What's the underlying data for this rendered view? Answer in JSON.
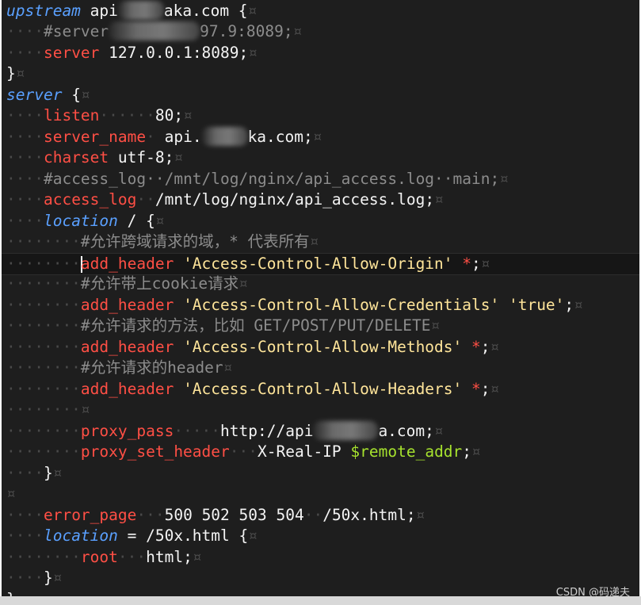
{
  "lines": [
    {
      "ws": "",
      "tokens": [
        {
          "t": "kw",
          "v": "upstream"
        },
        {
          "t": "txt",
          "v": " api"
        },
        {
          "t": "blur",
          "w": 58
        },
        {
          "t": "txt",
          "v": "aka.com {"
        },
        {
          "t": "ws",
          "v": "¤"
        }
      ]
    },
    {
      "ws": "····",
      "tokens": [
        {
          "t": "cmt",
          "v": "#server"
        },
        {
          "t": "blur",
          "w": 115
        },
        {
          "t": "cmt",
          "v": "97.9:8089;"
        },
        {
          "t": "ws",
          "v": "¤"
        }
      ]
    },
    {
      "ws": "····",
      "tokens": [
        {
          "t": "dir",
          "v": "server"
        },
        {
          "t": "txt",
          "v": " 127.0.0.1:8089;"
        },
        {
          "t": "ws",
          "v": "¤"
        }
      ]
    },
    {
      "ws": "",
      "tokens": [
        {
          "t": "txt",
          "v": "}"
        },
        {
          "t": "ws",
          "v": "¤"
        }
      ]
    },
    {
      "ws": "",
      "tokens": [
        {
          "t": "kw",
          "v": "server"
        },
        {
          "t": "txt",
          "v": " {"
        },
        {
          "t": "ws",
          "v": "¤"
        }
      ]
    },
    {
      "ws": "····",
      "tokens": [
        {
          "t": "dir",
          "v": "listen"
        },
        {
          "t": "ws",
          "v": "······"
        },
        {
          "t": "txt",
          "v": "80;"
        },
        {
          "t": "ws",
          "v": "¤"
        }
      ]
    },
    {
      "ws": "····",
      "tokens": [
        {
          "t": "dir",
          "v": "server_name"
        },
        {
          "t": "ws",
          "v": "·"
        },
        {
          "t": "txt",
          "v": " api."
        },
        {
          "t": "blur",
          "w": 58
        },
        {
          "t": "txt",
          "v": "ka.com;"
        },
        {
          "t": "ws",
          "v": "¤"
        }
      ]
    },
    {
      "ws": "····",
      "tokens": [
        {
          "t": "dir",
          "v": "charset"
        },
        {
          "t": "txt",
          "v": " utf-8;"
        },
        {
          "t": "ws",
          "v": "¤"
        }
      ]
    },
    {
      "ws": "····",
      "tokens": [
        {
          "t": "cmt",
          "v": "#access_log··/mnt/log/nginx/api_access.log··main;"
        },
        {
          "t": "ws",
          "v": "¤"
        }
      ]
    },
    {
      "ws": "····",
      "tokens": [
        {
          "t": "dir",
          "v": "access_log"
        },
        {
          "t": "ws",
          "v": "··"
        },
        {
          "t": "txt",
          "v": "/mnt/log/nginx/api_access.log;"
        },
        {
          "t": "ws",
          "v": "¤"
        }
      ]
    },
    {
      "ws": "····",
      "tokens": [
        {
          "t": "kw",
          "v": "location"
        },
        {
          "t": "txt",
          "v": " / {"
        },
        {
          "t": "ws",
          "v": "¤"
        }
      ]
    },
    {
      "ws": "········",
      "tokens": [
        {
          "t": "cmt",
          "v": "#允许跨域请求的域，* 代表所有"
        },
        {
          "t": "ws",
          "v": "¤"
        }
      ]
    },
    {
      "ws": "········",
      "current": true,
      "tokens": [
        {
          "t": "caret"
        },
        {
          "t": "dir",
          "v": "add_header"
        },
        {
          "t": "str",
          "v": " 'Access-Control-Allow-Origin'"
        },
        {
          "t": "dir",
          "v": " *"
        },
        {
          "t": "txt",
          "v": ";"
        },
        {
          "t": "ws",
          "v": "¤"
        }
      ]
    },
    {
      "ws": "········",
      "tokens": [
        {
          "t": "cmt",
          "v": "#允许带上cookie请求"
        },
        {
          "t": "ws",
          "v": "¤"
        }
      ]
    },
    {
      "ws": "········",
      "tokens": [
        {
          "t": "dir",
          "v": "add_header"
        },
        {
          "t": "str",
          "v": " 'Access-Control-Allow-Credentials'"
        },
        {
          "t": "str",
          "v": " 'true'"
        },
        {
          "t": "txt",
          "v": ";"
        },
        {
          "t": "ws",
          "v": "¤"
        }
      ]
    },
    {
      "ws": "········",
      "tokens": [
        {
          "t": "cmt",
          "v": "#允许请求的方法，比如 GET/POST/PUT/DELETE"
        },
        {
          "t": "ws",
          "v": "¤"
        }
      ]
    },
    {
      "ws": "········",
      "tokens": [
        {
          "t": "dir",
          "v": "add_header"
        },
        {
          "t": "str",
          "v": " 'Access-Control-Allow-Methods'"
        },
        {
          "t": "dir",
          "v": " *"
        },
        {
          "t": "txt",
          "v": ";"
        },
        {
          "t": "ws",
          "v": "¤"
        }
      ]
    },
    {
      "ws": "········",
      "tokens": [
        {
          "t": "cmt",
          "v": "#允许请求的header"
        },
        {
          "t": "ws",
          "v": "¤"
        }
      ]
    },
    {
      "ws": "········",
      "tokens": [
        {
          "t": "dir",
          "v": "add_header"
        },
        {
          "t": "str",
          "v": " 'Access-Control-Allow-Headers'"
        },
        {
          "t": "dir",
          "v": " *"
        },
        {
          "t": "txt",
          "v": ";"
        },
        {
          "t": "ws",
          "v": "¤"
        }
      ]
    },
    {
      "ws": "········",
      "tokens": [
        {
          "t": "ws",
          "v": "¤"
        }
      ]
    },
    {
      "ws": "········",
      "tokens": [
        {
          "t": "dir",
          "v": "proxy_pass"
        },
        {
          "t": "ws",
          "v": "·····"
        },
        {
          "t": "txt",
          "v": "http://api"
        },
        {
          "t": "blur",
          "w": 82
        },
        {
          "t": "txt",
          "v": "a.com;"
        },
        {
          "t": "ws",
          "v": "¤"
        }
      ]
    },
    {
      "ws": "········",
      "tokens": [
        {
          "t": "dir",
          "v": "proxy_set_header"
        },
        {
          "t": "ws",
          "v": "···"
        },
        {
          "t": "txt",
          "v": "X-Real-IP "
        },
        {
          "t": "var",
          "v": "$remote_addr"
        },
        {
          "t": "txt",
          "v": ";"
        },
        {
          "t": "ws",
          "v": "¤"
        }
      ]
    },
    {
      "ws": "····",
      "tokens": [
        {
          "t": "txt",
          "v": "}"
        },
        {
          "t": "ws",
          "v": "¤"
        }
      ]
    },
    {
      "ws": "",
      "tokens": [
        {
          "t": "ws",
          "v": "¤"
        }
      ]
    },
    {
      "ws": "····",
      "tokens": [
        {
          "t": "dir",
          "v": "error_page"
        },
        {
          "t": "ws",
          "v": "···"
        },
        {
          "t": "txt",
          "v": "500 502 503 504"
        },
        {
          "t": "ws",
          "v": "··"
        },
        {
          "t": "txt",
          "v": "/50x.html;"
        },
        {
          "t": "ws",
          "v": "¤"
        }
      ]
    },
    {
      "ws": "····",
      "tokens": [
        {
          "t": "kw",
          "v": "location"
        },
        {
          "t": "txt",
          "v": " = /50x.html {"
        },
        {
          "t": "ws",
          "v": "¤"
        }
      ]
    },
    {
      "ws": "········",
      "tokens": [
        {
          "t": "dir",
          "v": "root"
        },
        {
          "t": "ws",
          "v": "···"
        },
        {
          "t": "txt",
          "v": "html;"
        },
        {
          "t": "ws",
          "v": "¤"
        }
      ]
    },
    {
      "ws": "····",
      "tokens": [
        {
          "t": "txt",
          "v": "}"
        },
        {
          "t": "ws",
          "v": "¤"
        }
      ]
    },
    {
      "ws": "",
      "tokens": [
        {
          "t": "txt",
          "v": "}"
        }
      ]
    }
  ],
  "watermark": "CSDN @码递夫"
}
